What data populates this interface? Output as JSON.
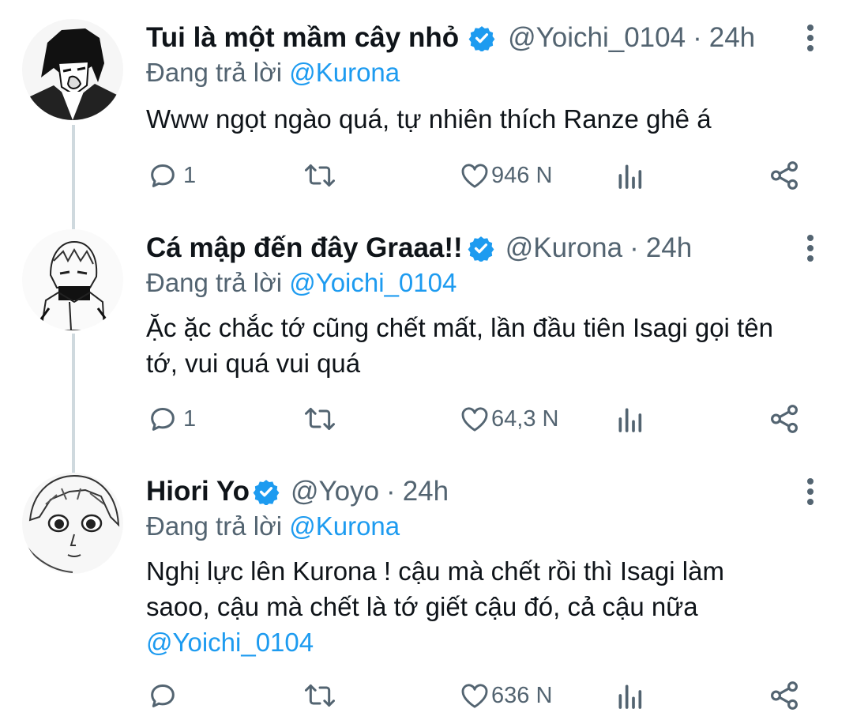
{
  "tweets": [
    {
      "display_name": "Tui là một mầm cây nhỏ",
      "handle": "@Yoichi_0104",
      "dot": "·",
      "time": "24h",
      "replying_prefix": "Đang trả lời",
      "replying_to": "@Kurona",
      "text": "Www ngọt ngào quá, tự nhiên thích Ranze ghê á",
      "mention": "",
      "reply_count": "1",
      "retweet_count": "",
      "like_count": "946 N",
      "verified": true
    },
    {
      "display_name": "Cá mập đến đây Graaa!!",
      "handle": "@Kurona",
      "dot": "·",
      "time": "24h",
      "replying_prefix": "Đang trả lời",
      "replying_to": "@Yoichi_0104",
      "text": "Ặc ặc chắc tớ cũng chết mất, lần đầu tiên Isagi gọi tên tớ, vui quá vui quá",
      "mention": "",
      "reply_count": "1",
      "retweet_count": "",
      "like_count": "64,3 N",
      "verified": true
    },
    {
      "display_name": "Hiori Yo",
      "handle": "@Yoyo",
      "dot": "·",
      "time": "24h",
      "replying_prefix": "Đang trả lời",
      "replying_to": "@Kurona",
      "text": "Nghị lực lên Kurona ! cậu mà chết rồi thì Isagi làm saoo, cậu mà chết là tớ giết cậu đó, cả cậu nữa",
      "mention": "@Yoichi_0104",
      "reply_count": "",
      "retweet_count": "",
      "like_count": "636 N",
      "verified": true
    }
  ],
  "colors": {
    "accent": "#1d9bf0",
    "secondary_text": "#536471",
    "primary_text": "#0f1419",
    "thread_line": "#cfd9de"
  },
  "icons": [
    "verified-badge-icon",
    "more-icon",
    "reply-icon",
    "retweet-icon",
    "like-icon",
    "views-icon",
    "share-icon"
  ]
}
